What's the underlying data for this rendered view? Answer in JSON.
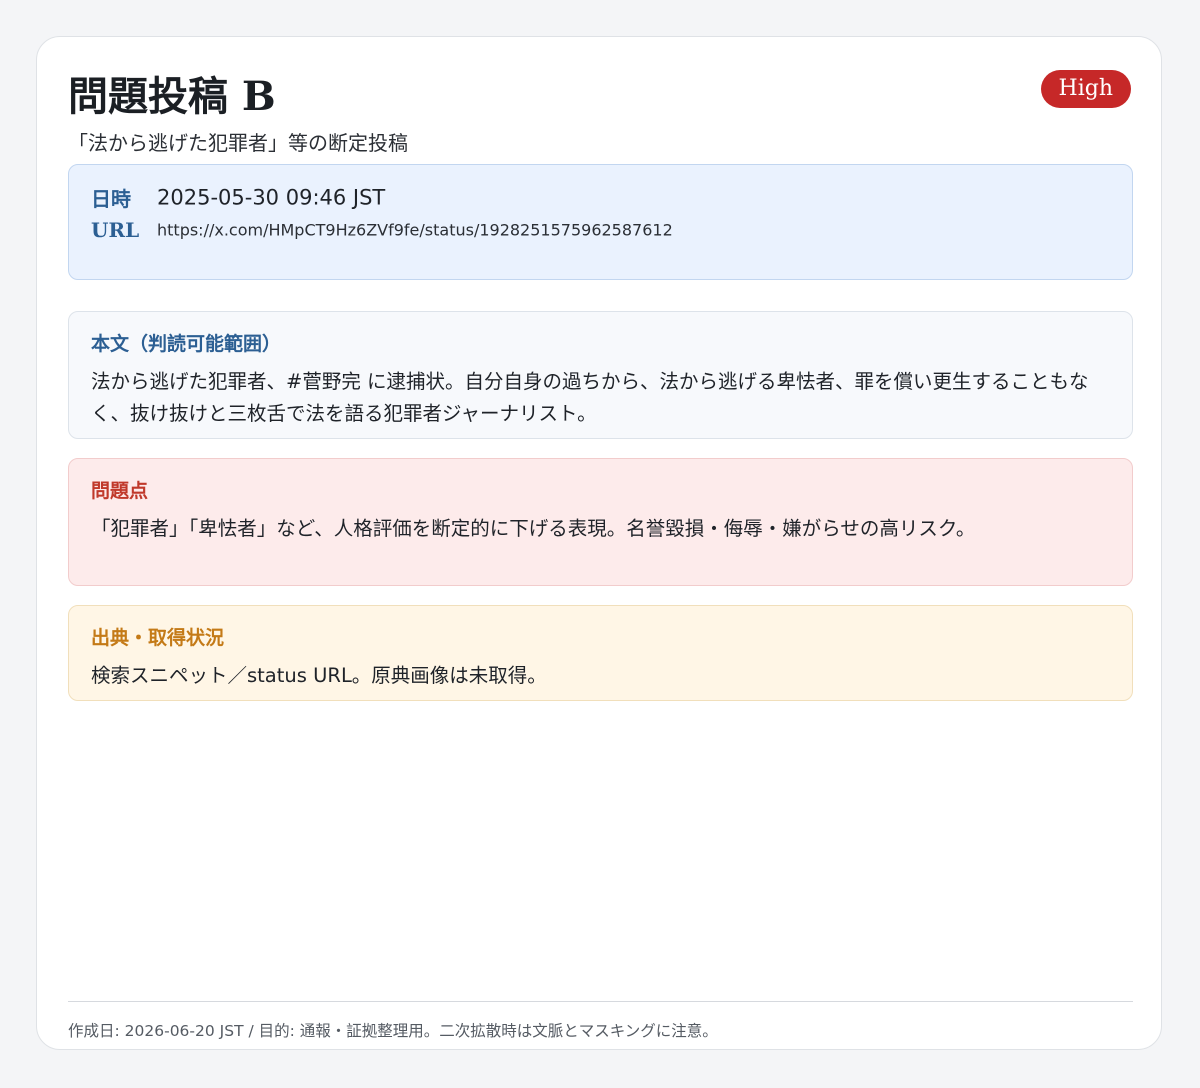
{
  "header": {
    "title": "問題投稿 B",
    "subtitle": "「法から逃げた犯罪者」等の断定投稿",
    "badge": "High"
  },
  "meta": {
    "date_label": "日時",
    "date_value": "2025-05-30 09:46 JST",
    "url_label": "URL",
    "url_value": "https://x.com/HMpCT9Hz6ZVf9fe/status/1928251575962587612"
  },
  "body_section": {
    "label": "本文（判読可能範囲）",
    "text": "法から逃げた犯罪者、#菅野完 に逮捕状。自分自身の過ちから、法から逃げる卑怯者、罪を償い更生することもなく、抜け抜けと三枚舌で法を語る犯罪者ジャーナリスト。"
  },
  "problem_section": {
    "label": "問題点",
    "text": "「犯罪者」「卑怯者」など、人格評価を断定的に下げる表現。名誉毀損・侮辱・嫌がらせの高リスク。"
  },
  "source_section": {
    "label": "出典・取得状況",
    "text": "検索スニペット／status URL。原典画像は未取得。"
  },
  "footer": {
    "text": "作成日: 2026-06-20 JST / 目的: 通報・証拠整理用。二次拡散時は文脈とマスキングに注意。"
  },
  "colors": {
    "badge": "#c62828",
    "label_blue": "#2c5f93",
    "label_red": "#c0392b",
    "label_orange": "#c47a17",
    "meta_bg": "#eaf2fe",
    "problem_bg": "#fdebeb",
    "source_bg": "#fff6e6"
  }
}
